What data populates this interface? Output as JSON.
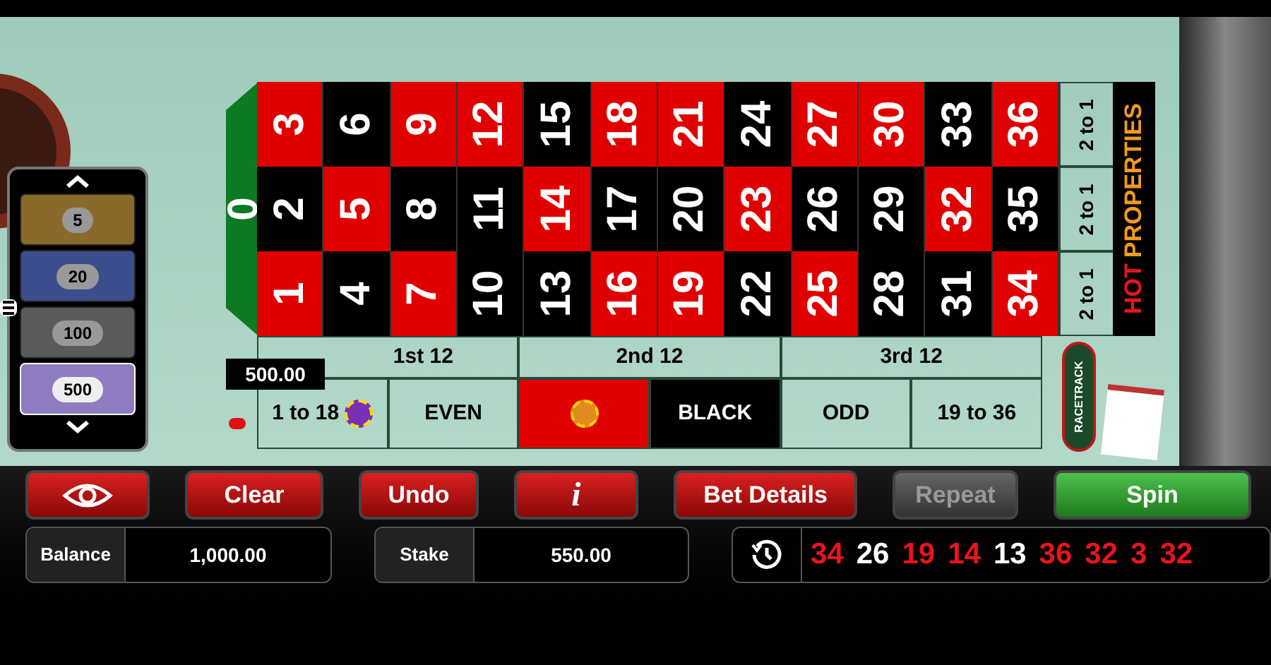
{
  "chips": [
    {
      "value": "5",
      "color": "#8a6a2a",
      "selected": false
    },
    {
      "value": "20",
      "color": "#3c4d8e",
      "selected": false
    },
    {
      "value": "100",
      "color": "#5a5a5a",
      "selected": false
    },
    {
      "value": "500",
      "color": "#8f7cc0",
      "selected": true
    }
  ],
  "zero": "0",
  "grid": [
    [
      {
        "number": "3",
        "color": "#e00000"
      },
      {
        "number": "6",
        "color": "#000000"
      },
      {
        "number": "9",
        "color": "#e00000"
      },
      {
        "number": "12",
        "color": "#e00000"
      },
      {
        "number": "15",
        "color": "#000000"
      },
      {
        "number": "18",
        "color": "#e00000"
      },
      {
        "number": "21",
        "color": "#e00000"
      },
      {
        "number": "24",
        "color": "#000000"
      },
      {
        "number": "27",
        "color": "#e00000"
      },
      {
        "number": "30",
        "color": "#e00000"
      },
      {
        "number": "33",
        "color": "#000000"
      },
      {
        "number": "36",
        "color": "#e00000"
      }
    ],
    [
      {
        "number": "2",
        "color": "#000000"
      },
      {
        "number": "5",
        "color": "#e00000"
      },
      {
        "number": "8",
        "color": "#000000"
      },
      {
        "number": "11",
        "color": "#000000"
      },
      {
        "number": "14",
        "color": "#e00000"
      },
      {
        "number": "17",
        "color": "#000000"
      },
      {
        "number": "20",
        "color": "#000000"
      },
      {
        "number": "23",
        "color": "#e00000"
      },
      {
        "number": "26",
        "color": "#000000"
      },
      {
        "number": "29",
        "color": "#000000"
      },
      {
        "number": "32",
        "color": "#e00000"
      },
      {
        "number": "35",
        "color": "#000000"
      }
    ],
    [
      {
        "number": "1",
        "color": "#e00000"
      },
      {
        "number": "4",
        "color": "#000000"
      },
      {
        "number": "7",
        "color": "#e00000"
      },
      {
        "number": "10",
        "color": "#000000"
      },
      {
        "number": "13",
        "color": "#000000"
      },
      {
        "number": "16",
        "color": "#e00000"
      },
      {
        "number": "19",
        "color": "#e00000"
      },
      {
        "number": "22",
        "color": "#000000"
      },
      {
        "number": "25",
        "color": "#e00000"
      },
      {
        "number": "28",
        "color": "#000000"
      },
      {
        "number": "31",
        "color": "#000000"
      },
      {
        "number": "34",
        "color": "#e00000"
      }
    ]
  ],
  "columns": [
    "2 to 1",
    "2 to 1",
    "2 to 1"
  ],
  "dozens": [
    "1st 12",
    "2nd 12",
    "3rd 12"
  ],
  "outside": [
    {
      "kind": "text",
      "label": "1 to 18",
      "chip": true
    },
    {
      "kind": "text",
      "label": "EVEN",
      "chip": false
    },
    {
      "kind": "red",
      "chip": true
    },
    {
      "kind": "black",
      "label": "BLACK",
      "chip": false
    },
    {
      "kind": "text",
      "label": "ODD",
      "chip": false
    },
    {
      "kind": "text",
      "label": "19 to 36",
      "chip": false
    }
  ],
  "bet_tooltip": "500.00",
  "hot_properties": [
    {
      "text": "HOT",
      "color": "#e8141c"
    },
    {
      "text": "PROPERTIES",
      "color": "#f29a1a"
    }
  ],
  "racetrack": "RACETRACK",
  "buttons": [
    {
      "kind": "eye",
      "disabled": false
    },
    {
      "kind": "text",
      "label": "Clear",
      "disabled": false
    },
    {
      "kind": "text",
      "label": "Undo",
      "disabled": false
    },
    {
      "kind": "info",
      "label": "i",
      "disabled": false
    },
    {
      "kind": "text",
      "label": "Bet Details",
      "disabled": false
    },
    {
      "kind": "text",
      "label": "Repeat",
      "disabled": true
    },
    {
      "kind": "spin",
      "label": "Spin",
      "disabled": false
    }
  ],
  "balance": {
    "label": "Balance",
    "value": "1,000.00"
  },
  "stake": {
    "label": "Stake",
    "value": "550.00"
  },
  "history": [
    {
      "number": "34",
      "color": "#e8141c"
    },
    {
      "number": "26",
      "color": "#ffffff"
    },
    {
      "number": "19",
      "color": "#e8141c"
    },
    {
      "number": "14",
      "color": "#e8141c"
    },
    {
      "number": "13",
      "color": "#ffffff"
    },
    {
      "number": "36",
      "color": "#e8141c"
    },
    {
      "number": "32",
      "color": "#e8141c"
    },
    {
      "number": "3",
      "color": "#e8141c"
    },
    {
      "number": "32",
      "color": "#e8141c"
    }
  ]
}
